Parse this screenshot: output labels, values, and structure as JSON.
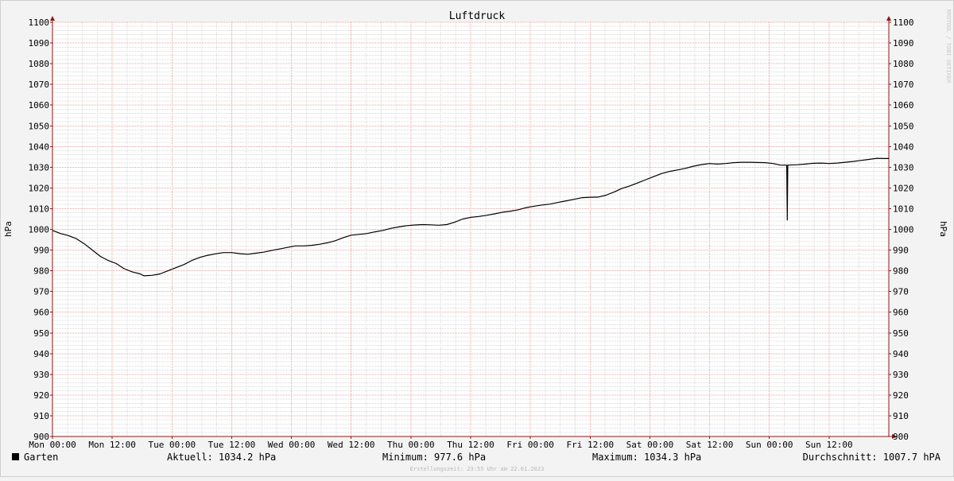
{
  "chart_data": {
    "type": "line",
    "title": "Luftdruck",
    "ylabel_left": "hPa",
    "ylabel_right": "hPa",
    "watermark": "RRDTOOL / TOBI OETIKER",
    "ylim": [
      900,
      1100
    ],
    "ytick_step": 10,
    "yticks": [
      "900",
      "910",
      "920",
      "930",
      "940",
      "950",
      "960",
      "970",
      "980",
      "990",
      "1000",
      "1010",
      "1020",
      "1030",
      "1040",
      "1050",
      "1060",
      "1070",
      "1080",
      "1090",
      "1100"
    ],
    "xlim_hours": [
      0,
      168
    ],
    "xticks": [
      {
        "label": "Mon 00:00",
        "hour": 0
      },
      {
        "label": "Mon 12:00",
        "hour": 12
      },
      {
        "label": "Tue 00:00",
        "hour": 24
      },
      {
        "label": "Tue 12:00",
        "hour": 36
      },
      {
        "label": "Wed 00:00",
        "hour": 48
      },
      {
        "label": "Wed 12:00",
        "hour": 60
      },
      {
        "label": "Thu 00:00",
        "hour": 72
      },
      {
        "label": "Thu 12:00",
        "hour": 84
      },
      {
        "label": "Fri 00:00",
        "hour": 96
      },
      {
        "label": "Fri 12:00",
        "hour": 108
      },
      {
        "label": "Sat 00:00",
        "hour": 120
      },
      {
        "label": "Sat 12:00",
        "hour": 132
      },
      {
        "label": "Sun 00:00",
        "hour": 144
      },
      {
        "label": "Sun 12:00",
        "hour": 156
      }
    ],
    "grid": true,
    "series": [
      {
        "name": "Garten",
        "color": "#000000",
        "points": [
          [
            0,
            999.5
          ],
          [
            1.6,
            998.0
          ],
          [
            3.2,
            997.0
          ],
          [
            4.8,
            995.5
          ],
          [
            6.4,
            993.0
          ],
          [
            8,
            990.0
          ],
          [
            9.6,
            987.0
          ],
          [
            11.2,
            985.0
          ],
          [
            12.8,
            983.5
          ],
          [
            14.4,
            981.0
          ],
          [
            16,
            979.5
          ],
          [
            17.6,
            978.5
          ],
          [
            18.4,
            977.6
          ],
          [
            20,
            977.8
          ],
          [
            21.6,
            978.5
          ],
          [
            23.2,
            980.0
          ],
          [
            24.8,
            981.5
          ],
          [
            26.4,
            983.0
          ],
          [
            28,
            985.0
          ],
          [
            29.6,
            986.5
          ],
          [
            31.2,
            987.5
          ],
          [
            32.8,
            988.2
          ],
          [
            34.4,
            988.8
          ],
          [
            36,
            988.8
          ],
          [
            37.6,
            988.3
          ],
          [
            39.2,
            988.0
          ],
          [
            40.8,
            988.5
          ],
          [
            42.4,
            989.0
          ],
          [
            44,
            989.8
          ],
          [
            45.6,
            990.5
          ],
          [
            47.2,
            991.3
          ],
          [
            48.8,
            992.0
          ],
          [
            50.4,
            992.0
          ],
          [
            52,
            992.3
          ],
          [
            53.6,
            992.8
          ],
          [
            55.2,
            993.5
          ],
          [
            56.8,
            994.5
          ],
          [
            58.4,
            996.0
          ],
          [
            60,
            997.2
          ],
          [
            61.6,
            997.6
          ],
          [
            63.2,
            998.0
          ],
          [
            64.8,
            998.8
          ],
          [
            66.4,
            999.5
          ],
          [
            68,
            1000.5
          ],
          [
            69.6,
            1001.2
          ],
          [
            71.2,
            1001.8
          ],
          [
            72.8,
            1002.1
          ],
          [
            74.4,
            1002.3
          ],
          [
            76,
            1002.2
          ],
          [
            77.6,
            1002.0
          ],
          [
            79.2,
            1002.3
          ],
          [
            80.8,
            1003.5
          ],
          [
            82.4,
            1005.0
          ],
          [
            84,
            1005.8
          ],
          [
            85.6,
            1006.2
          ],
          [
            87.2,
            1006.8
          ],
          [
            88.8,
            1007.5
          ],
          [
            90.4,
            1008.3
          ],
          [
            92,
            1008.8
          ],
          [
            93.6,
            1009.5
          ],
          [
            95.2,
            1010.5
          ],
          [
            96.8,
            1011.2
          ],
          [
            98.4,
            1011.8
          ],
          [
            100,
            1012.2
          ],
          [
            101.6,
            1013.0
          ],
          [
            103.2,
            1013.8
          ],
          [
            104.8,
            1014.5
          ],
          [
            106.4,
            1015.3
          ],
          [
            108,
            1015.5
          ],
          [
            109.6,
            1015.6
          ],
          [
            111.2,
            1016.5
          ],
          [
            112.8,
            1018.0
          ],
          [
            114.4,
            1019.8
          ],
          [
            116,
            1021.0
          ],
          [
            117.6,
            1022.5
          ],
          [
            119.2,
            1024.0
          ],
          [
            120.8,
            1025.5
          ],
          [
            122.4,
            1027.0
          ],
          [
            124,
            1028.0
          ],
          [
            125.6,
            1028.7
          ],
          [
            127.2,
            1029.5
          ],
          [
            128.8,
            1030.5
          ],
          [
            130.4,
            1031.3
          ],
          [
            132,
            1031.8
          ],
          [
            133.6,
            1031.5
          ],
          [
            135.2,
            1031.8
          ],
          [
            136.8,
            1032.2
          ],
          [
            138.4,
            1032.4
          ],
          [
            140,
            1032.4
          ],
          [
            141.6,
            1032.3
          ],
          [
            143.2,
            1032.2
          ],
          [
            144.8,
            1031.8
          ],
          [
            146.2,
            1031.0
          ],
          [
            147.5,
            1031.0
          ],
          [
            147.6,
            1004.5
          ],
          [
            147.7,
            1031.0
          ],
          [
            149.6,
            1031.2
          ],
          [
            151.2,
            1031.5
          ],
          [
            152.8,
            1031.9
          ],
          [
            154.4,
            1032.0
          ],
          [
            156,
            1031.8
          ],
          [
            157.6,
            1032.0
          ],
          [
            159.2,
            1032.4
          ],
          [
            160.8,
            1032.8
          ],
          [
            162.4,
            1033.3
          ],
          [
            164,
            1033.8
          ],
          [
            165.6,
            1034.3
          ],
          [
            167,
            1034.2
          ],
          [
            168,
            1034.2
          ]
        ]
      }
    ]
  },
  "legend": {
    "series_name": "Garten",
    "series_color": "#000000",
    "aktuell": "Aktuell: 1034.2 hPa",
    "minimum": "Minimum: 977.6 hPa",
    "maximum": "Maximum: 1034.3 hPa",
    "durchschnitt": "Durchschnitt: 1007.7 hPA",
    "timestamp": "Erstellungszeit: 23:55 Uhr am 22.01.2023"
  },
  "colors": {
    "background": "#f3f3f3",
    "canvas": "#ffffff",
    "grid_major": "#f0a0a0",
    "grid_minor": "#d8d8d8",
    "axis": "#8b1a1a",
    "text": "#000000",
    "watermark": "#c8c8c8",
    "timestamp": "#b8b8b8"
  }
}
